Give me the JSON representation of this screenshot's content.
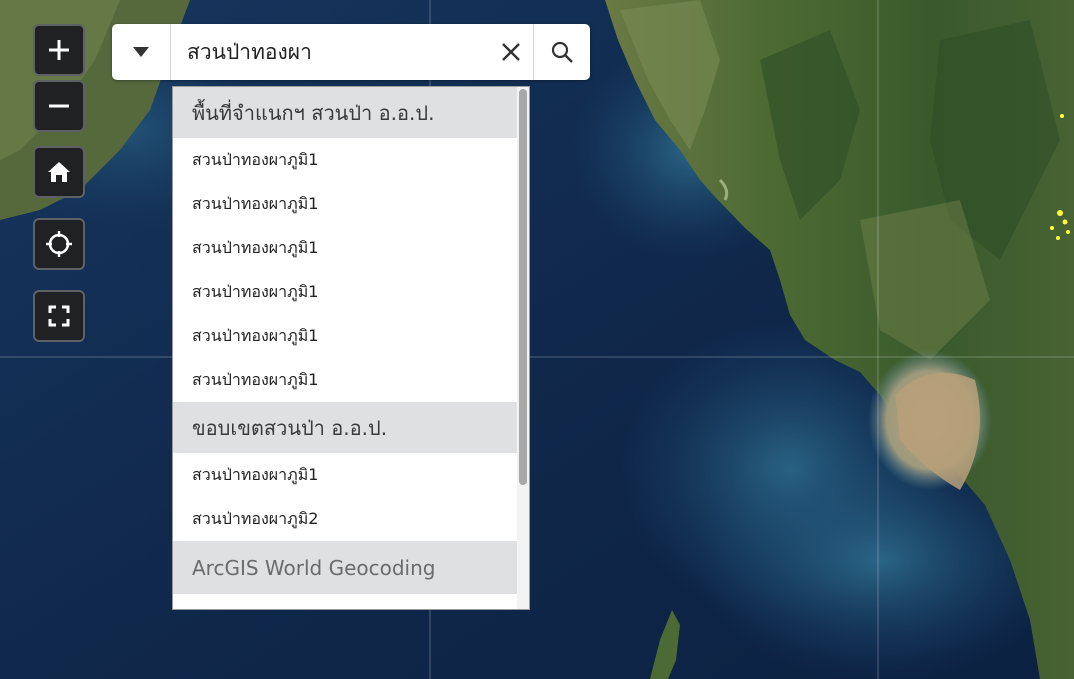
{
  "map": {
    "type": "satellite basemap",
    "colors": {
      "ocean": "#12305a",
      "land": "#4e6a33",
      "sediment": "#b49b77",
      "marker": "#ffff33"
    }
  },
  "controls": [
    {
      "name": "zoom-in-button",
      "icon": "plus-icon"
    },
    {
      "name": "zoom-out-button",
      "icon": "minus-icon"
    },
    {
      "name": "home-button",
      "icon": "home-icon"
    },
    {
      "name": "locate-button",
      "icon": "crosshair-icon"
    },
    {
      "name": "fullscreen-button",
      "icon": "expand-icon"
    }
  ],
  "search": {
    "value": "สวนป่าทองผา",
    "source_toggle_icon": "caret-down-icon",
    "clear_icon": "close-icon",
    "search_icon": "search-icon"
  },
  "suggestions": {
    "groups": [
      {
        "header": "พื้นที่จำแนกฯ สวนป่า อ.อ.ป.",
        "items": [
          "สวนป่าทองผาภูมิ1",
          "สวนป่าทองผาภูมิ1",
          "สวนป่าทองผาภูมิ1",
          "สวนป่าทองผาภูมิ1",
          "สวนป่าทองผาภูมิ1",
          "สวนป่าทองผาภูมิ1"
        ]
      },
      {
        "header": "ขอบเขตสวนป่า อ.อ.ป.",
        "items": [
          "สวนป่าทองผาภูมิ1",
          "สวนป่าทองผาภูมิ2"
        ]
      },
      {
        "header": "ArcGIS World Geocoding",
        "items": []
      }
    ]
  }
}
